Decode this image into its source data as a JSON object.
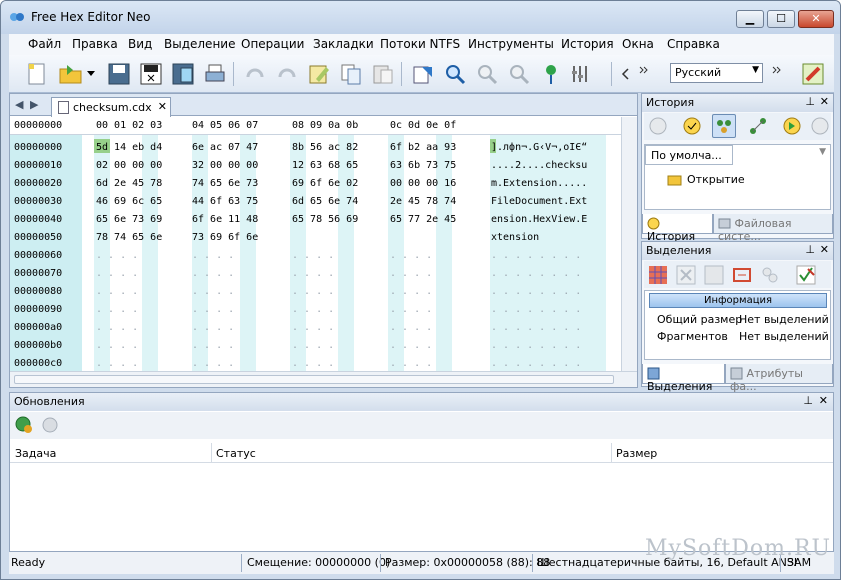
{
  "window": {
    "title": "Free Hex Editor Neo",
    "minimize": "▁",
    "maximize": "☐",
    "close": "✕"
  },
  "menu": [
    "Файл",
    "Правка",
    "Вид",
    "Выделение",
    "Операции",
    "Закладки",
    "Потоки NTFS",
    "Инструменты",
    "История",
    "Окна",
    "Справка"
  ],
  "toolbar": {
    "language": "Русский",
    "icons": [
      "new-file-icon",
      "open-folder-icon",
      "dropdown-arrow-icon",
      "save-icon",
      "save-all-icon",
      "save-as-icon",
      "print-icon",
      "undo-icon",
      "redo-icon",
      "edit-icon",
      "copy-icon",
      "paste-icon",
      "go-to-icon",
      "find-icon",
      "find-next-icon",
      "find-prev-icon",
      "bookmark-icon",
      "settings-icon",
      "chevron-left-icon",
      "more-icon",
      "language-select",
      "more-icon-2",
      "highlighter-icon"
    ],
    "colors": {
      "accent": "#d6e6f5",
      "hex_highlight": "#97d08a"
    }
  },
  "editor": {
    "tab_label": "checksum.cdx",
    "tab_close": "✕",
    "nav_left": "◀",
    "nav_right": "▶",
    "header_offset": "00000000",
    "header_groups": [
      "00 01 02 03",
      "04 05 06 07",
      "08 09 0a 0b",
      "0c 0d 0e 0f"
    ],
    "rows": [
      {
        "offset": "00000000",
        "groups": [
          "5d 14 eb d4",
          "6e ac 07 47",
          "8b 56 ac 82",
          "6f b2 aa 93"
        ],
        "text": "].лфn¬.G‹V¬,oІЄ“"
      },
      {
        "offset": "00000010",
        "groups": [
          "02 00 00 00",
          "32 00 00 00",
          "12 63 68 65",
          "63 6b 73 75"
        ],
        "text": "....2....checksu"
      },
      {
        "offset": "00000020",
        "groups": [
          "6d 2e 45 78",
          "74 65 6e 73",
          "69 6f 6e 02",
          "00 00 00 16"
        ],
        "text": "m.Extension....."
      },
      {
        "offset": "00000030",
        "groups": [
          "46 69 6c 65",
          "44 6f 63 75",
          "6d 65 6e 74",
          "2e 45 78 74"
        ],
        "text": "FileDocument.Ext"
      },
      {
        "offset": "00000040",
        "groups": [
          "65 6e 73 69",
          "6f 6e 11 48",
          "65 78 56 69",
          "65 77 2e 45"
        ],
        "text": "ension.HexView.E"
      },
      {
        "offset": "00000050",
        "groups": [
          "78 74 65 6e",
          "73 69 6f 6e",
          "",
          ""
        ],
        "text": "xtension"
      },
      {
        "offset": "00000060",
        "groups": [
          ". . . .",
          ". . . .",
          ". . . .",
          ". . . ."
        ],
        "text": ". . . . . . . ."
      },
      {
        "offset": "00000070",
        "groups": [
          ". . . .",
          ". . . .",
          ". . . .",
          ". . . ."
        ],
        "text": ". . . . . . . ."
      },
      {
        "offset": "00000080",
        "groups": [
          ". . . .",
          ". . . .",
          ". . . .",
          ". . . ."
        ],
        "text": ". . . . . . . ."
      },
      {
        "offset": "00000090",
        "groups": [
          ". . . .",
          ". . . .",
          ". . . .",
          ". . . ."
        ],
        "text": ". . . . . . . ."
      },
      {
        "offset": "000000a0",
        "groups": [
          ". . . .",
          ". . . .",
          ". . . .",
          ". . . ."
        ],
        "text": ". . . . . . . ."
      },
      {
        "offset": "000000b0",
        "groups": [
          ". . . .",
          ". . . .",
          ". . . .",
          ". . . ."
        ],
        "text": ". . . . . . . ."
      },
      {
        "offset": "000000c0",
        "groups": [
          ". . . .",
          ". . . .",
          ". . . .",
          ". . . ."
        ],
        "text": ". . . . . . . ."
      }
    ]
  },
  "history_panel": {
    "title": "История",
    "pin": "⊥",
    "close": "✕",
    "dropdown_label": "По умолча...",
    "entry": "Открытие",
    "tab_history": "История",
    "tab_file_system": "Файловая систе..."
  },
  "selection_panel": {
    "title": "Выделения",
    "pin": "⊥",
    "close": "✕",
    "info_button": "Информация",
    "rows": [
      {
        "label": "Общий размер",
        "value": "Нет выделений"
      },
      {
        "label": "Фрагментов",
        "value": "Нет выделений"
      }
    ],
    "tab_selections": "Выделения",
    "tab_attributes": "Атрибуты фа..."
  },
  "updates_panel": {
    "title": "Обновления",
    "pin": "⊥",
    "close": "✕",
    "columns": [
      "Задача",
      "Статус",
      "Размер"
    ]
  },
  "statusbar": {
    "ready": "Ready",
    "offset": "Смещение: 00000000 (0)",
    "size": "Размер: 0x00000058 (88): 88",
    "mode": "Шестнадцатеричные байты, 16, Default ANSI",
    "ins": "ЗАМ"
  },
  "watermark": "MySoftDom.RU"
}
